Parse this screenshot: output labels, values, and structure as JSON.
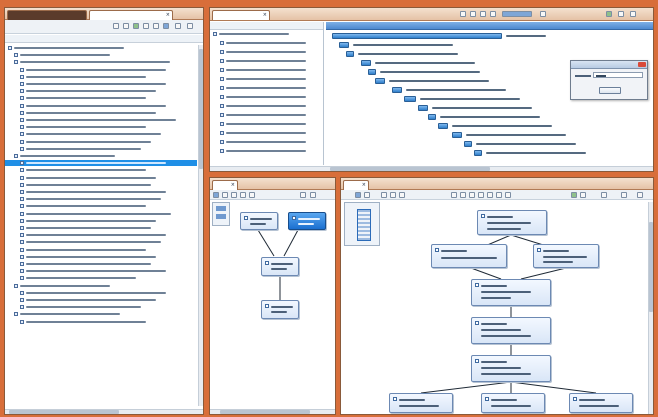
{
  "window": {
    "title": ""
  },
  "left_panel": {
    "tabs": [
      {
        "label": ""
      },
      {
        "label": ""
      }
    ],
    "header": "",
    "tree_rows": 39,
    "selected_row": 16
  },
  "gantt_panel": {
    "tab": "",
    "header": "",
    "rows": 14
  },
  "dialog": {
    "title": "",
    "field_label": "",
    "field_value": "",
    "button_label": ""
  },
  "mini_diagram_panel": {
    "tab": ""
  },
  "main_diagram_panel": {
    "tab": ""
  },
  "colors": {
    "accent": "#d86e3a",
    "selection": "#1f8fe6",
    "bar": "#2f7fcb"
  }
}
